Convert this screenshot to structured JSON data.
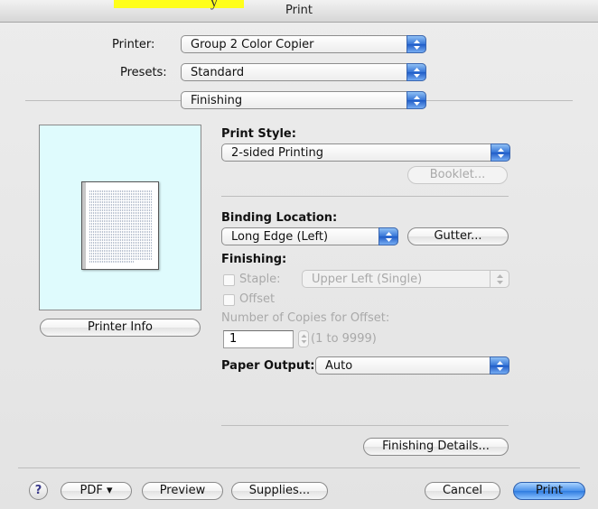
{
  "window": {
    "title": "Print",
    "marker_glyph": "y"
  },
  "printer": {
    "label": "Printer:",
    "value": "Group 2 Color Copier"
  },
  "presets": {
    "label": "Presets:",
    "value": "Standard"
  },
  "panel": {
    "value": "Finishing"
  },
  "preview": {
    "printer_info_label": "Printer Info"
  },
  "print_style": {
    "label": "Print Style:",
    "value": "2-sided Printing",
    "booklet_label": "Booklet..."
  },
  "binding": {
    "label": "Binding Location:",
    "value": "Long Edge (Left)",
    "gutter_label": "Gutter..."
  },
  "finishing": {
    "label": "Finishing:",
    "staple_label": "Staple:",
    "staple_value": "Upper Left (Single)",
    "offset_label": "Offset",
    "copies_label": "Number of Copies for Offset:",
    "copies_value": "1",
    "copies_range": "(1 to 9999)"
  },
  "paper_output": {
    "label": "Paper Output:",
    "value": "Auto"
  },
  "finishing_details_label": "Finishing Details...",
  "footer": {
    "help_label": "?",
    "pdf_label": "PDF ▾",
    "preview_label": "Preview",
    "supplies_label": "Supplies...",
    "cancel_label": "Cancel",
    "print_label": "Print"
  },
  "colors": {
    "accent": "#3574d6",
    "preview_bg": "#dffbfd",
    "highlight": "#ffff1a"
  }
}
